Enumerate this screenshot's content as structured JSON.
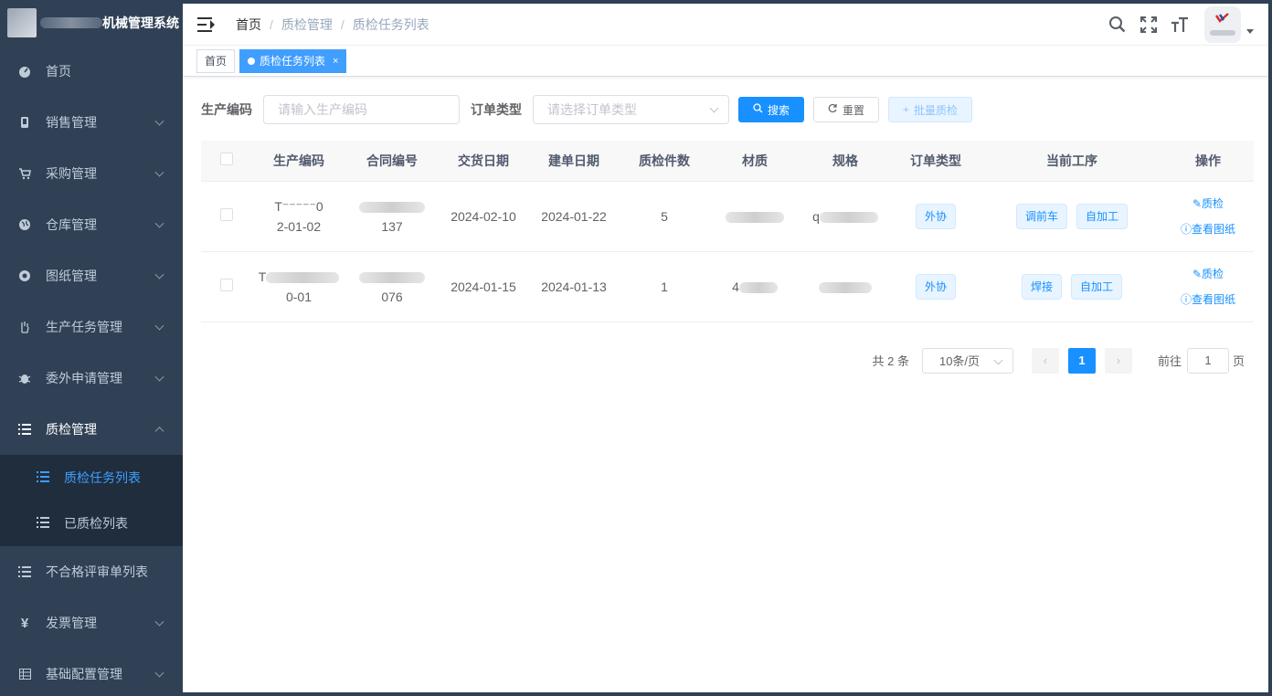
{
  "app": {
    "title": "机械管理系统"
  },
  "sidebar": {
    "items": [
      {
        "label": "首页",
        "icon": "dashboard-icon"
      },
      {
        "label": "销售管理",
        "icon": "phone-icon"
      },
      {
        "label": "采购管理",
        "icon": "cart-icon"
      },
      {
        "label": "仓库管理",
        "icon": "globe-icon"
      },
      {
        "label": "图纸管理",
        "icon": "aperture-icon"
      },
      {
        "label": "生产任务管理",
        "icon": "hand-icon"
      },
      {
        "label": "委外申请管理",
        "icon": "bug-icon"
      },
      {
        "label": "质检管理",
        "icon": "list-icon"
      }
    ],
    "sub_items": [
      {
        "label": "质检任务列表",
        "active": true
      },
      {
        "label": "已质检列表",
        "active": false
      }
    ],
    "bottom_items": [
      {
        "label": "不合格评审单列表"
      },
      {
        "label": "发票管理"
      },
      {
        "label": "基础配置管理"
      }
    ]
  },
  "breadcrumb": [
    "首页",
    "质检管理",
    "质检任务列表"
  ],
  "tags": {
    "home": "首页",
    "active": "质检任务列表",
    "close": "×"
  },
  "search": {
    "code_label": "生产编码",
    "code_placeholder": "请输入生产编码",
    "type_label": "订单类型",
    "type_placeholder": "请选择订单类型",
    "search_btn": "搜索",
    "reset_btn": "重置",
    "batch_btn": "批量质检"
  },
  "table": {
    "headers": [
      "生产编码",
      "合同编号",
      "交货日期",
      "建单日期",
      "质检件数",
      "材质",
      "规格",
      "订单类型",
      "当前工序",
      "操作"
    ],
    "rows": [
      {
        "code_top": "T⁻⁻⁻⁻⁻0",
        "code_bottom": "2-01-02",
        "contract_bottom": "137",
        "delivery": "2024-02-10",
        "created": "2024-01-22",
        "qty": "5",
        "spec_prefix": "q",
        "material_prefix": "",
        "order_type": "外协",
        "process": [
          "调前车",
          "自加工"
        ],
        "ops": [
          "质检",
          "查看图纸"
        ]
      },
      {
        "code_top": "T",
        "code_bottom": "0-01",
        "contract_bottom": "076",
        "delivery": "2024-01-15",
        "created": "2024-01-13",
        "qty": "1",
        "spec_prefix": "",
        "material_prefix": "4",
        "order_type": "外协",
        "process": [
          "焊接",
          "自加工"
        ],
        "ops": [
          "质检",
          "查看图纸"
        ]
      }
    ]
  },
  "pagination": {
    "total": "共 2 条",
    "page_size": "10条/页",
    "current": "1",
    "goto_label": "前往",
    "goto_value": "1",
    "page_suffix": "页"
  }
}
